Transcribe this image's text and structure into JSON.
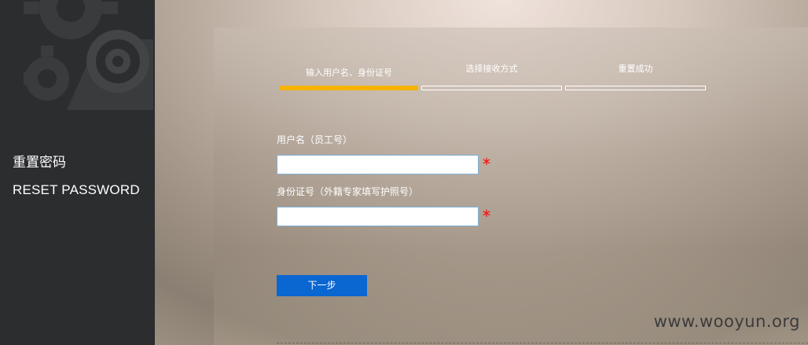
{
  "sidebar": {
    "title_cn": "重置密码",
    "title_en": "RESET PASSWORD"
  },
  "steps": [
    {
      "label": "输入用户名、身份证号",
      "active": true
    },
    {
      "label": "选择接收方式",
      "active": false
    },
    {
      "label": "重置成功",
      "active": false
    }
  ],
  "form": {
    "username_label": "用户名（员工号）",
    "username_value": "",
    "id_label": "身份证号（外籍专家填写护照号）",
    "id_value": "",
    "required_mark": "*",
    "next_label": "下一步"
  },
  "watermark": "www.wooyun.org",
  "colors": {
    "sidebar_bg": "#2c2d2f",
    "active_step": "#f5b400",
    "button": "#0a66d1",
    "required": "#ff0000"
  }
}
